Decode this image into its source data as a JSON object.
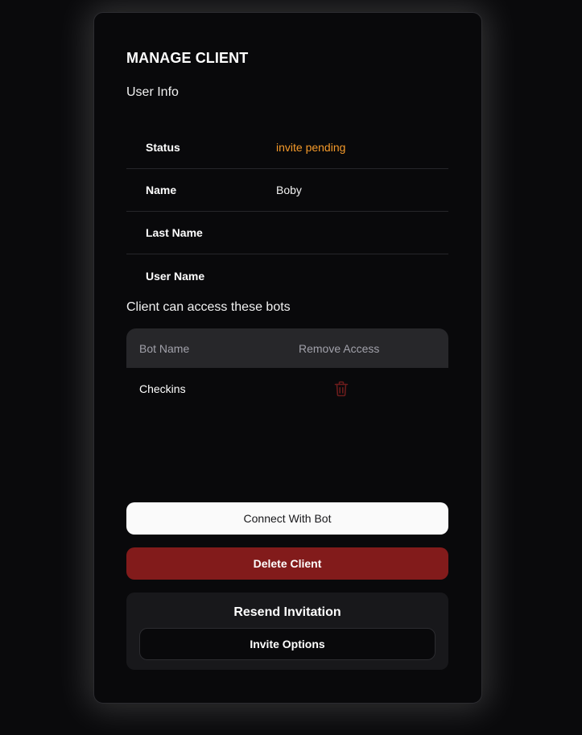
{
  "modal": {
    "title": "MANAGE CLIENT"
  },
  "user_info": {
    "heading": "User Info",
    "rows": [
      {
        "label": "Status",
        "value": "invite pending"
      },
      {
        "label": "Name",
        "value": "Boby"
      },
      {
        "label": "Last Name",
        "value": ""
      },
      {
        "label": "User Name",
        "value": ""
      }
    ]
  },
  "bots": {
    "heading": "Client can access these bots",
    "columns": [
      "Bot Name",
      "Remove Access"
    ],
    "rows": [
      {
        "name": "Checkins",
        "action_icon": "trash-icon"
      }
    ]
  },
  "actions": {
    "connect_label": "Connect With Bot",
    "delete_label": "Delete Client"
  },
  "resend": {
    "title": "Resend Invitation",
    "invite_options_label": "Invite Options"
  },
  "colors": {
    "background": "#09090b",
    "pending_status": "#f59a2a",
    "danger": "#821b1b",
    "trash_icon": "#6b1c1c",
    "table_header": "#27272a"
  }
}
